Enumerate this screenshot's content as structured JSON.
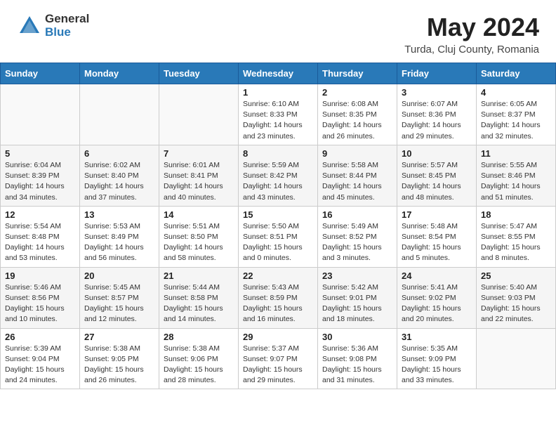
{
  "header": {
    "logo_general": "General",
    "logo_blue": "Blue",
    "title": "May 2024",
    "location": "Turda, Cluj County, Romania"
  },
  "weekdays": [
    "Sunday",
    "Monday",
    "Tuesday",
    "Wednesday",
    "Thursday",
    "Friday",
    "Saturday"
  ],
  "weeks": [
    [
      {
        "day": "",
        "sunrise": "",
        "sunset": "",
        "daylight": ""
      },
      {
        "day": "",
        "sunrise": "",
        "sunset": "",
        "daylight": ""
      },
      {
        "day": "",
        "sunrise": "",
        "sunset": "",
        "daylight": ""
      },
      {
        "day": "1",
        "sunrise": "Sunrise: 6:10 AM",
        "sunset": "Sunset: 8:33 PM",
        "daylight": "Daylight: 14 hours and 23 minutes."
      },
      {
        "day": "2",
        "sunrise": "Sunrise: 6:08 AM",
        "sunset": "Sunset: 8:35 PM",
        "daylight": "Daylight: 14 hours and 26 minutes."
      },
      {
        "day": "3",
        "sunrise": "Sunrise: 6:07 AM",
        "sunset": "Sunset: 8:36 PM",
        "daylight": "Daylight: 14 hours and 29 minutes."
      },
      {
        "day": "4",
        "sunrise": "Sunrise: 6:05 AM",
        "sunset": "Sunset: 8:37 PM",
        "daylight": "Daylight: 14 hours and 32 minutes."
      }
    ],
    [
      {
        "day": "5",
        "sunrise": "Sunrise: 6:04 AM",
        "sunset": "Sunset: 8:39 PM",
        "daylight": "Daylight: 14 hours and 34 minutes."
      },
      {
        "day": "6",
        "sunrise": "Sunrise: 6:02 AM",
        "sunset": "Sunset: 8:40 PM",
        "daylight": "Daylight: 14 hours and 37 minutes."
      },
      {
        "day": "7",
        "sunrise": "Sunrise: 6:01 AM",
        "sunset": "Sunset: 8:41 PM",
        "daylight": "Daylight: 14 hours and 40 minutes."
      },
      {
        "day": "8",
        "sunrise": "Sunrise: 5:59 AM",
        "sunset": "Sunset: 8:42 PM",
        "daylight": "Daylight: 14 hours and 43 minutes."
      },
      {
        "day": "9",
        "sunrise": "Sunrise: 5:58 AM",
        "sunset": "Sunset: 8:44 PM",
        "daylight": "Daylight: 14 hours and 45 minutes."
      },
      {
        "day": "10",
        "sunrise": "Sunrise: 5:57 AM",
        "sunset": "Sunset: 8:45 PM",
        "daylight": "Daylight: 14 hours and 48 minutes."
      },
      {
        "day": "11",
        "sunrise": "Sunrise: 5:55 AM",
        "sunset": "Sunset: 8:46 PM",
        "daylight": "Daylight: 14 hours and 51 minutes."
      }
    ],
    [
      {
        "day": "12",
        "sunrise": "Sunrise: 5:54 AM",
        "sunset": "Sunset: 8:48 PM",
        "daylight": "Daylight: 14 hours and 53 minutes."
      },
      {
        "day": "13",
        "sunrise": "Sunrise: 5:53 AM",
        "sunset": "Sunset: 8:49 PM",
        "daylight": "Daylight: 14 hours and 56 minutes."
      },
      {
        "day": "14",
        "sunrise": "Sunrise: 5:51 AM",
        "sunset": "Sunset: 8:50 PM",
        "daylight": "Daylight: 14 hours and 58 minutes."
      },
      {
        "day": "15",
        "sunrise": "Sunrise: 5:50 AM",
        "sunset": "Sunset: 8:51 PM",
        "daylight": "Daylight: 15 hours and 0 minutes."
      },
      {
        "day": "16",
        "sunrise": "Sunrise: 5:49 AM",
        "sunset": "Sunset: 8:52 PM",
        "daylight": "Daylight: 15 hours and 3 minutes."
      },
      {
        "day": "17",
        "sunrise": "Sunrise: 5:48 AM",
        "sunset": "Sunset: 8:54 PM",
        "daylight": "Daylight: 15 hours and 5 minutes."
      },
      {
        "day": "18",
        "sunrise": "Sunrise: 5:47 AM",
        "sunset": "Sunset: 8:55 PM",
        "daylight": "Daylight: 15 hours and 8 minutes."
      }
    ],
    [
      {
        "day": "19",
        "sunrise": "Sunrise: 5:46 AM",
        "sunset": "Sunset: 8:56 PM",
        "daylight": "Daylight: 15 hours and 10 minutes."
      },
      {
        "day": "20",
        "sunrise": "Sunrise: 5:45 AM",
        "sunset": "Sunset: 8:57 PM",
        "daylight": "Daylight: 15 hours and 12 minutes."
      },
      {
        "day": "21",
        "sunrise": "Sunrise: 5:44 AM",
        "sunset": "Sunset: 8:58 PM",
        "daylight": "Daylight: 15 hours and 14 minutes."
      },
      {
        "day": "22",
        "sunrise": "Sunrise: 5:43 AM",
        "sunset": "Sunset: 8:59 PM",
        "daylight": "Daylight: 15 hours and 16 minutes."
      },
      {
        "day": "23",
        "sunrise": "Sunrise: 5:42 AM",
        "sunset": "Sunset: 9:01 PM",
        "daylight": "Daylight: 15 hours and 18 minutes."
      },
      {
        "day": "24",
        "sunrise": "Sunrise: 5:41 AM",
        "sunset": "Sunset: 9:02 PM",
        "daylight": "Daylight: 15 hours and 20 minutes."
      },
      {
        "day": "25",
        "sunrise": "Sunrise: 5:40 AM",
        "sunset": "Sunset: 9:03 PM",
        "daylight": "Daylight: 15 hours and 22 minutes."
      }
    ],
    [
      {
        "day": "26",
        "sunrise": "Sunrise: 5:39 AM",
        "sunset": "Sunset: 9:04 PM",
        "daylight": "Daylight: 15 hours and 24 minutes."
      },
      {
        "day": "27",
        "sunrise": "Sunrise: 5:38 AM",
        "sunset": "Sunset: 9:05 PM",
        "daylight": "Daylight: 15 hours and 26 minutes."
      },
      {
        "day": "28",
        "sunrise": "Sunrise: 5:38 AM",
        "sunset": "Sunset: 9:06 PM",
        "daylight": "Daylight: 15 hours and 28 minutes."
      },
      {
        "day": "29",
        "sunrise": "Sunrise: 5:37 AM",
        "sunset": "Sunset: 9:07 PM",
        "daylight": "Daylight: 15 hours and 29 minutes."
      },
      {
        "day": "30",
        "sunrise": "Sunrise: 5:36 AM",
        "sunset": "Sunset: 9:08 PM",
        "daylight": "Daylight: 15 hours and 31 minutes."
      },
      {
        "day": "31",
        "sunrise": "Sunrise: 5:35 AM",
        "sunset": "Sunset: 9:09 PM",
        "daylight": "Daylight: 15 hours and 33 minutes."
      },
      {
        "day": "",
        "sunrise": "",
        "sunset": "",
        "daylight": ""
      }
    ]
  ]
}
